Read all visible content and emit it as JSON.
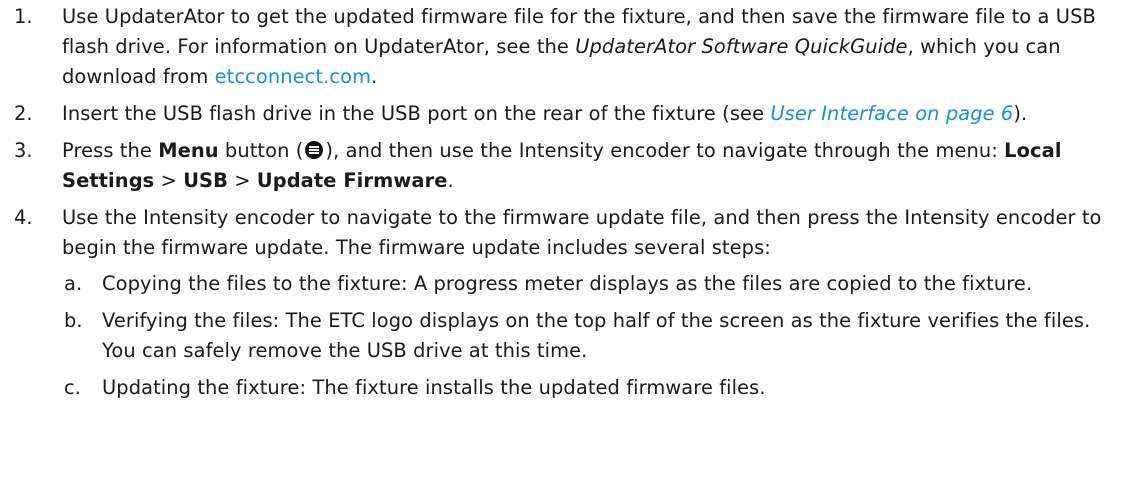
{
  "steps": [
    {
      "num": "1.",
      "text_a": "Use UpdaterAtor to get the updated firmware file for the fixture, and then save the firmware file to a USB flash drive. For information on UpdaterAtor, see the ",
      "guide_title": "UpdaterAtor Software QuickGuide",
      "text_b": ", which you can download from ",
      "link": "etcconnect.com",
      "text_c": "."
    },
    {
      "num": "2.",
      "text_a": "Insert the USB flash drive in the USB port on the rear of the fixture (see ",
      "xref": "User Interface on page 6",
      "text_b": ")."
    },
    {
      "num": "3.",
      "text_a": "Press the ",
      "bold_menu": "Menu",
      "text_b": " button (",
      "icon": "menu-icon",
      "text_c": "), and then use the Intensity encoder to navigate through the menu: ",
      "path1": "Local Settings",
      "sep1": " > ",
      "path2": "USB",
      "sep2": " > ",
      "path3": "Update Firmware",
      "text_d": "."
    },
    {
      "num": "4.",
      "text_a": "Use the Intensity encoder to navigate to the firmware update file, and then press the Intensity encoder to begin the firmware update. The firmware update includes several steps:",
      "substeps": [
        {
          "letter": "a.",
          "text": "Copying the files to the fixture: A progress meter displays as the files are copied to the fixture."
        },
        {
          "letter": "b.",
          "text": "Verifying the files: The ETC logo displays on the top half of the screen as the fixture verifies the files. You can safely remove the USB drive at this time."
        },
        {
          "letter": "c.",
          "text": "Updating the fixture: The fixture installs the updated firmware files."
        }
      ]
    }
  ]
}
